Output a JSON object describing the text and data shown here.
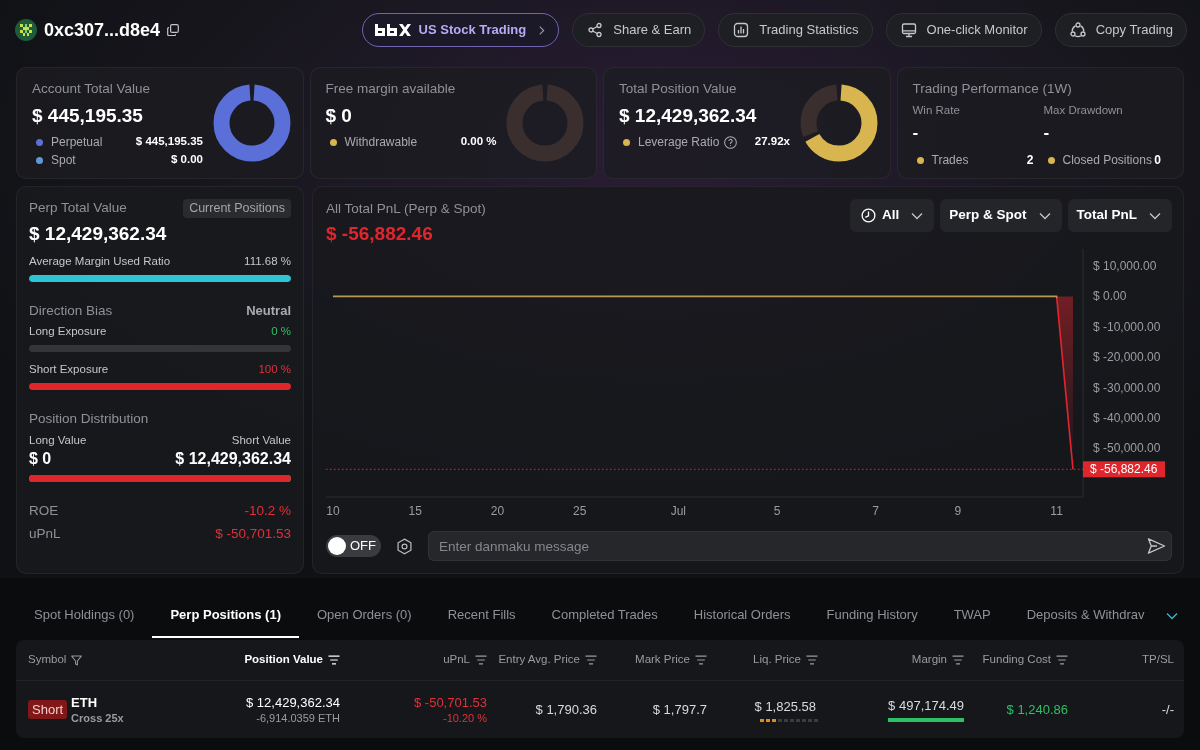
{
  "header": {
    "address": "0xc307...d8e4",
    "buttons": [
      {
        "kind": "featured",
        "label": "US Stock Trading"
      },
      {
        "kind": "share",
        "label": "Share & Earn"
      },
      {
        "kind": "stats",
        "label": "Trading Statistics"
      },
      {
        "kind": "monitor",
        "label": "One-click Monitor"
      },
      {
        "kind": "copy",
        "label": "Copy Trading"
      }
    ]
  },
  "summary_cards": [
    {
      "kind": "ring",
      "title": "Account Total Value",
      "value": "$ 445,195.35",
      "legend": [
        {
          "label": "Perpetual",
          "value": "$ 445,195.35",
          "color": "#5b6fd8",
          "help": false
        },
        {
          "label": "Spot",
          "value": "$ 0.00",
          "color": "#5e9ad8",
          "help": false
        }
      ],
      "ring": {
        "level": 1,
        "color": "#5b6fd8"
      }
    },
    {
      "kind": "ring",
      "title": "Free margin available",
      "value": "$ 0",
      "legend": [
        {
          "label": "Withdrawable",
          "value": "0.00 %",
          "color": "#d8b54e",
          "help": false
        }
      ]
    },
    {
      "kind": "ring",
      "title": "Total Position Value",
      "value": "$ 12,429,362.34",
      "legend": [
        {
          "label": "Leverage Ratio",
          "value": "27.92x",
          "color": "#d8b54e",
          "help": true
        }
      ],
      "ring": {
        "level": 0.68,
        "color": "#d8b54e"
      }
    },
    {
      "kind": "performance",
      "title": "Trading Performance (1W)",
      "stats": [
        {
          "label": "Win Rate",
          "value": "-"
        },
        {
          "label": "Max Drawdown",
          "value": "-"
        }
      ],
      "legend": [
        {
          "label": "Trades",
          "value": "2",
          "color": "#d8b54e",
          "help": false
        },
        {
          "label": "Closed Positions",
          "value": "0",
          "color": "#d8b54e",
          "help": false
        }
      ]
    }
  ],
  "perp_panel": {
    "title": "Perp Total Value",
    "badge": "Current Positions",
    "value": "$ 12,429,362.34",
    "margin_ratio": {
      "label": "Average Margin Used Ratio",
      "value": "111.68 %",
      "level": 1
    },
    "direction": {
      "label": "Direction Bias",
      "value": "Neutral"
    },
    "exposures": [
      {
        "kind": "long",
        "label": "Long Exposure",
        "value": "0 %"
      },
      {
        "kind": "short",
        "label": "Short Exposure",
        "value": "100 %",
        "level": 1
      }
    ],
    "distribution": {
      "title": "Position Distribution",
      "long": {
        "label": "Long Value",
        "value": "$ 0"
      },
      "short": {
        "label": "Short Value",
        "value": "$ 12,429,362.34",
        "level": 1
      }
    },
    "metrics": [
      {
        "label": "ROE",
        "value": "-10.2 %",
        "negative": true
      },
      {
        "label": "uPnL",
        "value": "$ -50,701.53",
        "negative": true
      }
    ]
  },
  "pnl_panel": {
    "value": "$ -56,882.46",
    "filters": [
      {
        "kind": "period",
        "label": "All"
      },
      {
        "kind": "select",
        "label": "Perp & Spot"
      },
      {
        "kind": "select",
        "label": "Total PnL"
      }
    ],
    "chart_data": {
      "type": "area",
      "title": "All Total PnL (Perp & Spot)",
      "categories": [
        "10",
        null,
        null,
        null,
        null,
        "15",
        null,
        null,
        null,
        null,
        "20",
        null,
        null,
        null,
        null,
        "25",
        null,
        null,
        null,
        null,
        null,
        "Jul",
        null,
        null,
        null,
        null,
        null,
        "5",
        null,
        null,
        null,
        null,
        null,
        "7",
        null,
        null,
        null,
        null,
        "9",
        null,
        null,
        null,
        null,
        null,
        "11",
        null
      ],
      "values": [
        0,
        0,
        0,
        0,
        0,
        0,
        0,
        0,
        0,
        0,
        0,
        0,
        0,
        0,
        0,
        0,
        0,
        0,
        0,
        0,
        0,
        0,
        0,
        0,
        0,
        0,
        0,
        0,
        0,
        0,
        0,
        0,
        0,
        0,
        0,
        0,
        0,
        0,
        0,
        0,
        0,
        0,
        0,
        0,
        0,
        -56882.46
      ],
      "ylim": [
        -66000,
        15600
      ],
      "yticks": [
        {
          "value": 10000,
          "label": "$ 10,000.00"
        },
        {
          "value": 0,
          "label": "$ 0.00"
        },
        {
          "value": -10000,
          "label": "$ -10,000.00"
        },
        {
          "value": -20000,
          "label": "$ -20,000.00"
        },
        {
          "value": -30000,
          "label": "$ -30,000.00"
        },
        {
          "value": -40000,
          "label": "$ -40,000.00"
        },
        {
          "value": -50000,
          "label": "$ -50,000.00"
        }
      ],
      "ref_lines": [
        {
          "axis": "y",
          "value": -56882.46,
          "label": "$ -56,882.46"
        }
      ]
    },
    "danmaku": {
      "toggle": {
        "label": "OFF",
        "on": false
      },
      "placeholder": "Enter danmaku message"
    }
  },
  "positions": {
    "tabs": [
      {
        "label": "Spot Holdings (0)",
        "selected": false
      },
      {
        "label": "Perp Positions (1)",
        "selected": true
      },
      {
        "label": "Open Orders (0)",
        "selected": false
      },
      {
        "label": "Recent Fills",
        "selected": false
      },
      {
        "label": "Completed Trades",
        "selected": false
      },
      {
        "label": "Historical Orders",
        "selected": false
      },
      {
        "label": "Funding History",
        "selected": false
      },
      {
        "label": "TWAP",
        "selected": false
      },
      {
        "label": "Deposits & Withdrav",
        "selected": false
      }
    ],
    "columns": [
      {
        "label": "Symbol",
        "kind": "filter",
        "sorted": false
      },
      {
        "label": "Position Value",
        "kind": "sort",
        "sorted": true
      },
      {
        "label": "uPnL",
        "kind": "sort",
        "sorted": false
      },
      {
        "label": "Entry Avg. Price",
        "kind": "sort",
        "sorted": false
      },
      {
        "label": "Mark Price",
        "kind": "sort",
        "sorted": false
      },
      {
        "label": "Liq. Price",
        "kind": "sort",
        "sorted": false
      },
      {
        "label": "Margin",
        "kind": "sort",
        "sorted": false
      },
      {
        "label": "Funding Cost",
        "kind": "sort",
        "sorted": false
      },
      {
        "label": "TP/SL",
        "kind": "plain",
        "sorted": false
      }
    ],
    "rows": [
      {
        "kind": "short",
        "side": "Short",
        "symbol": "ETH",
        "mode": "Cross 25x",
        "position_value": "$ 12,429,362.34",
        "size": "-6,914.0359 ETH",
        "upnl": "$ -50,701.53",
        "upnl_pct": "-10.20 %",
        "upnl_negative": true,
        "entry_price": "$ 1,790.36",
        "mark_price": "$ 1,797.7",
        "liq_price": "$ 1,825.58",
        "liq_risk": {
          "level": 0.3
        },
        "margin": "$ 497,174.49",
        "margin_bar": {
          "level": 1
        },
        "funding_cost": "$ 1,240.86",
        "funding_positive": true,
        "tp_sl": "-/-"
      }
    ]
  }
}
